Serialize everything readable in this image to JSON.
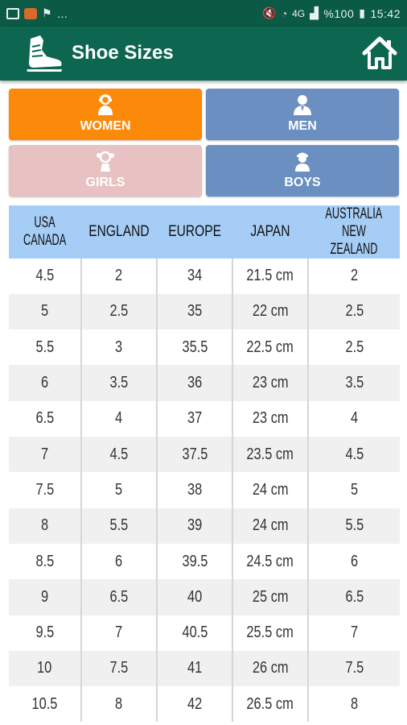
{
  "status_bar": {
    "dots": "...",
    "battery": "%100",
    "time": "15:42",
    "network": "4G"
  },
  "app_bar": {
    "title": "Shoe Sizes"
  },
  "categories": [
    {
      "label": "WOMEN",
      "color": "#fb8a0b",
      "icon": "woman-icon"
    },
    {
      "label": "MEN",
      "color": "#6a8fc0",
      "icon": "man-icon"
    },
    {
      "label": "GIRLS",
      "color": "#e8c2c2",
      "icon": "girl-icon"
    },
    {
      "label": "BOYS",
      "color": "#6a8fc0",
      "icon": "boy-icon"
    }
  ],
  "table": {
    "headers": [
      [
        "USA",
        "CANADA"
      ],
      [
        "ENGLAND"
      ],
      [
        "EUROPE"
      ],
      [
        "JAPAN"
      ],
      [
        "AUSTRALİA",
        "NEW ZEALAND"
      ]
    ],
    "rows": [
      [
        "4.5",
        "2",
        "34",
        "21.5 cm",
        "2"
      ],
      [
        "5",
        "2.5",
        "35",
        "22 cm",
        "2.5"
      ],
      [
        "5.5",
        "3",
        "35.5",
        "22.5 cm",
        "2.5"
      ],
      [
        "6",
        "3.5",
        "36",
        "23 cm",
        "3.5"
      ],
      [
        "6.5",
        "4",
        "37",
        "23 cm",
        "4"
      ],
      [
        "7",
        "4.5",
        "37.5",
        "23.5 cm",
        "4.5"
      ],
      [
        "7.5",
        "5",
        "38",
        "24 cm",
        "5"
      ],
      [
        "8",
        "5.5",
        "39",
        "24 cm",
        "5.5"
      ],
      [
        "8.5",
        "6",
        "39.5",
        "24.5 cm",
        "6"
      ],
      [
        "9",
        "6.5",
        "40",
        "25 cm",
        "6.5"
      ],
      [
        "9.5",
        "7",
        "40.5",
        "25.5 cm",
        "7"
      ],
      [
        "10",
        "7.5",
        "41",
        "26 cm",
        "7.5"
      ],
      [
        "10.5",
        "8",
        "42",
        "26.5 cm",
        "8"
      ]
    ]
  },
  "colors": {
    "status_bar": "#0b5a45",
    "app_bar": "#0d6650",
    "table_header": "#a6cdf5",
    "row_alt": "#f0f0f0"
  }
}
